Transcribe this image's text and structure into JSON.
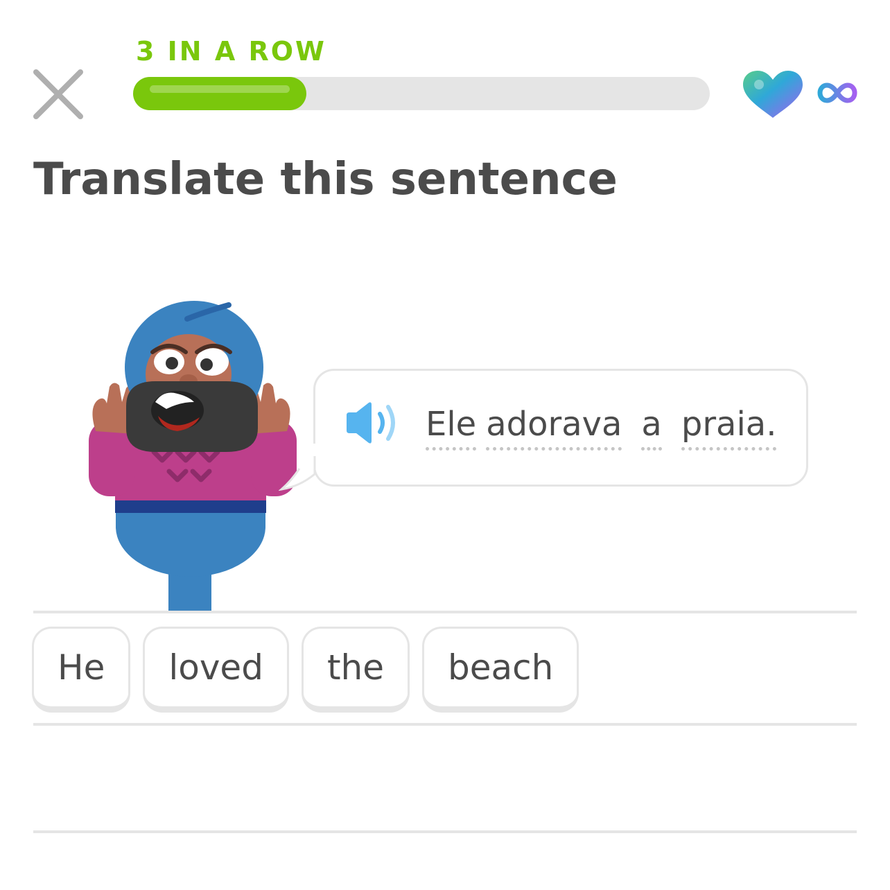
{
  "header": {
    "streak_label": "3 IN A ROW",
    "progress": 0.3,
    "lives": "∞",
    "close_icon": "close-icon",
    "heart_icon": "heart-icon",
    "colors": {
      "accent": "#7ac70c",
      "track": "#e5e5e5"
    }
  },
  "exercise": {
    "title": "Translate this sentence",
    "prompt_tokens": [
      "Ele",
      "adorava",
      "a",
      "praia."
    ],
    "speaker_icon": "speaker-icon"
  },
  "answer": {
    "selected_words": [
      "He",
      "loved",
      "the",
      "beach"
    ]
  }
}
